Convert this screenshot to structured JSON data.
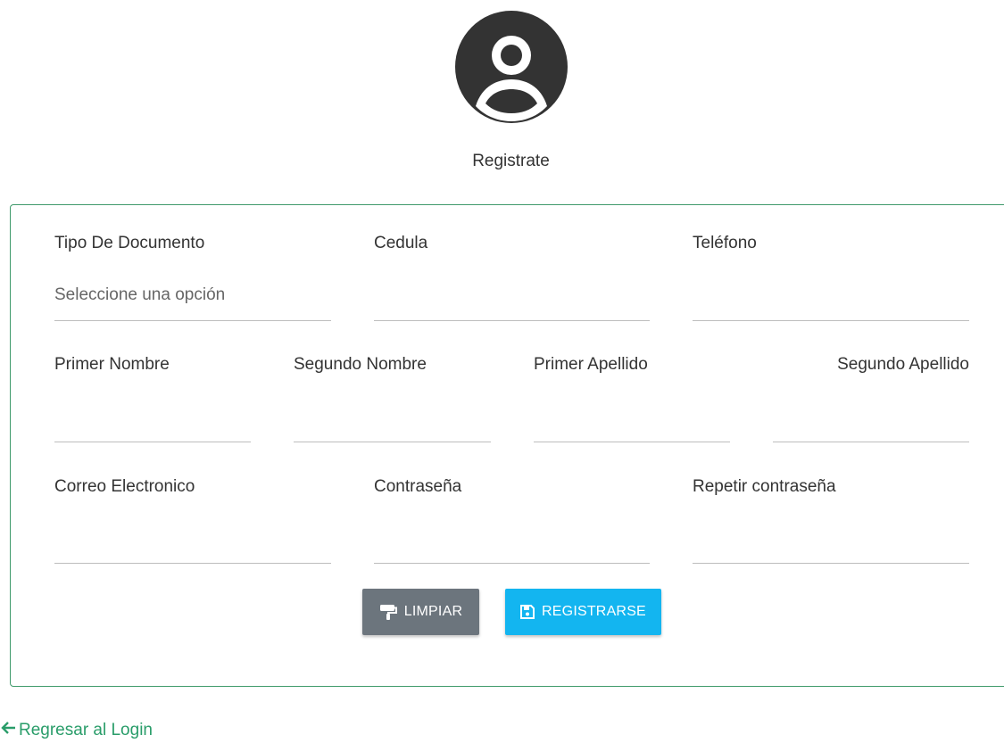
{
  "header": {
    "avatar_icon": "user-circle-icon",
    "title": "Registrate"
  },
  "form": {
    "tipo_documento": {
      "label": "Tipo De Documento",
      "placeholder": "Seleccione una opción"
    },
    "cedula": {
      "label": "Cedula",
      "value": ""
    },
    "telefono": {
      "label": "Teléfono",
      "value": ""
    },
    "primer_nombre": {
      "label": "Primer Nombre",
      "value": ""
    },
    "segundo_nombre": {
      "label": "Segundo Nombre",
      "value": ""
    },
    "primer_apellido": {
      "label": "Primer Apellido",
      "value": ""
    },
    "segundo_apellido": {
      "label": "Segundo Apellido",
      "value": ""
    },
    "correo": {
      "label": "Correo Electronico",
      "value": ""
    },
    "contrasena": {
      "label": "Contraseña",
      "value": ""
    },
    "repetir_contrasena": {
      "label": "Repetir contraseña",
      "value": ""
    }
  },
  "buttons": {
    "clear": {
      "label": "LIMPIAR",
      "icon": "paint-roller-icon"
    },
    "register": {
      "label": "REGISTRARSE",
      "icon": "save-icon"
    }
  },
  "footer": {
    "back_icon": "arrow-left-icon",
    "back_label": "Regresar al Login"
  },
  "colors": {
    "card_border": "#3f9a6b",
    "link": "#2a9d6a",
    "clear_button": "#6c757d",
    "register_button": "#13b5f0",
    "avatar": "#333333"
  }
}
